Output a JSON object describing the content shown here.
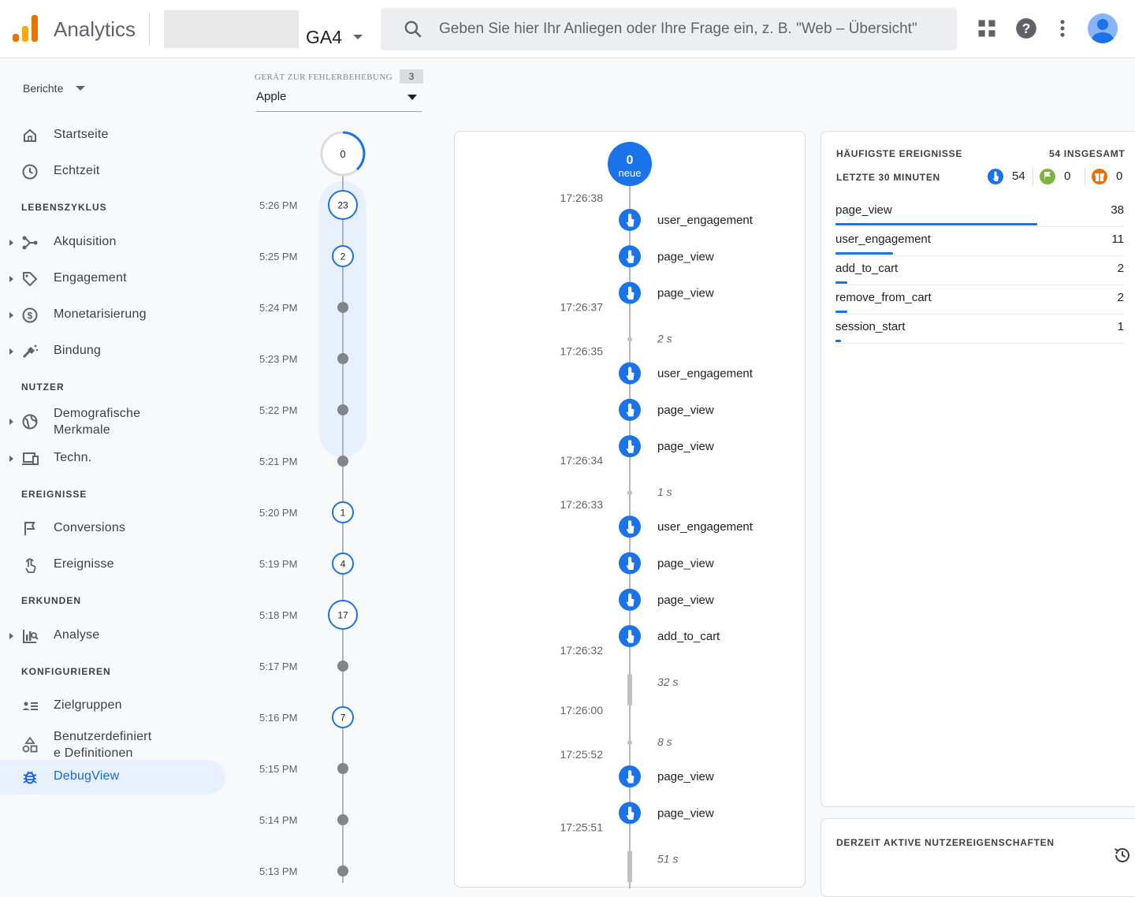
{
  "header": {
    "app_title": "Analytics",
    "property": "GA4",
    "search_placeholder": "Geben Sie hier Ihr Anliegen oder Ihre Frage ein, z. B. \"Web – Übersicht\"",
    "brand_colors": [
      "#f9ab00",
      "#e37400"
    ]
  },
  "sidebar": {
    "reports_label": "Berichte",
    "items": [
      {
        "label": "Startseite",
        "icon": "home-icon"
      },
      {
        "label": "Echtzeit",
        "icon": "clock-icon"
      },
      {
        "section": "LEBENSZYKLUS"
      },
      {
        "label": "Akquisition",
        "icon": "acquisition-icon",
        "expandable": true
      },
      {
        "label": "Engagement",
        "icon": "tag-icon",
        "expandable": true
      },
      {
        "label": "Monetarisierung",
        "icon": "dollar-icon",
        "expandable": true
      },
      {
        "label": "Bindung",
        "icon": "retention-icon",
        "expandable": true
      },
      {
        "section": "NUTZER"
      },
      {
        "label": "Demografische Merkmale",
        "icon": "globe-icon",
        "expandable": true
      },
      {
        "label": "Techn.",
        "icon": "devices-icon",
        "expandable": true
      },
      {
        "section": "EREIGNISSE"
      },
      {
        "label": "Conversions",
        "icon": "flag-icon"
      },
      {
        "label": "Ereignisse",
        "icon": "touch-icon"
      },
      {
        "section": "ERKUNDEN"
      },
      {
        "label": "Analyse",
        "icon": "explore-icon",
        "expandable": true
      },
      {
        "section": "KONFIGURIEREN"
      },
      {
        "label": "Zielgruppen",
        "icon": "audience-icon"
      },
      {
        "label": "Benutzerdefinierte Definitionen",
        "icon": "shapes-icon"
      },
      {
        "label": "DebugView",
        "icon": "bug-icon",
        "active": true
      }
    ]
  },
  "device": {
    "label": "GERÄT ZUR FEHLERBEHEBUNG",
    "count": "3",
    "selected": "Apple"
  },
  "minutes": {
    "top_count": "0",
    "rows": [
      {
        "time": "5:26 PM",
        "count": "23",
        "highlight": true
      },
      {
        "time": "5:25 PM",
        "count": "2",
        "highlight": true
      },
      {
        "time": "5:24 PM",
        "count": null,
        "highlight": true
      },
      {
        "time": "5:23 PM",
        "count": null,
        "highlight": true
      },
      {
        "time": "5:22 PM",
        "count": null,
        "highlight": true
      },
      {
        "time": "5:21 PM",
        "count": null
      },
      {
        "time": "5:20 PM",
        "count": "1"
      },
      {
        "time": "5:19 PM",
        "count": "4"
      },
      {
        "time": "5:18 PM",
        "count": "17"
      },
      {
        "time": "5:17 PM",
        "count": null
      },
      {
        "time": "5:16 PM",
        "count": "7"
      },
      {
        "time": "5:15 PM",
        "count": null
      },
      {
        "time": "5:14 PM",
        "count": null
      },
      {
        "time": "5:13 PM",
        "count": null
      }
    ]
  },
  "stream": {
    "top_count": "0",
    "top_label": "neue",
    "items": [
      {
        "kind": "time",
        "text": "17:26:38"
      },
      {
        "kind": "event",
        "text": "user_engagement"
      },
      {
        "kind": "event",
        "text": "page_view"
      },
      {
        "kind": "event",
        "text": "page_view"
      },
      {
        "kind": "time",
        "text": "17:26:37"
      },
      {
        "kind": "gap",
        "text": "2 s"
      },
      {
        "kind": "time",
        "text": "17:26:35"
      },
      {
        "kind": "event",
        "text": "user_engagement"
      },
      {
        "kind": "event",
        "text": "page_view"
      },
      {
        "kind": "event",
        "text": "page_view"
      },
      {
        "kind": "time",
        "text": "17:26:34"
      },
      {
        "kind": "gap",
        "text": "1 s"
      },
      {
        "kind": "time",
        "text": "17:26:33"
      },
      {
        "kind": "event",
        "text": "user_engagement"
      },
      {
        "kind": "event",
        "text": "page_view"
      },
      {
        "kind": "event",
        "text": "page_view"
      },
      {
        "kind": "event",
        "text": "add_to_cart"
      },
      {
        "kind": "time",
        "text": "17:26:32"
      },
      {
        "kind": "gap",
        "text": "32 s",
        "long": true
      },
      {
        "kind": "time",
        "text": "17:26:00"
      },
      {
        "kind": "gap",
        "text": "8 s"
      },
      {
        "kind": "time",
        "text": "17:25:52"
      },
      {
        "kind": "event",
        "text": "page_view"
      },
      {
        "kind": "event",
        "text": "page_view"
      },
      {
        "kind": "time",
        "text": "17:25:51"
      },
      {
        "kind": "gap",
        "text": "51 s",
        "long": true
      }
    ]
  },
  "top_events": {
    "title": "HÄUFIGSTE EREIGNISSE",
    "total": "54 INSGESAMT",
    "period": "LETZTE 30 MINUTEN",
    "counters": [
      {
        "icon": "touch-icon",
        "value": "54",
        "color": "#1a73e8"
      },
      {
        "icon": "flag-icon",
        "value": "0",
        "color": "#7cb342"
      },
      {
        "icon": "gift-icon",
        "value": "0",
        "color": "#e8710a"
      }
    ],
    "rows": [
      {
        "name": "page_view",
        "count": "38",
        "share": 0.7
      },
      {
        "name": "user_engagement",
        "count": "11",
        "share": 0.2
      },
      {
        "name": "add_to_cart",
        "count": "2",
        "share": 0.04
      },
      {
        "name": "remove_from_cart",
        "count": "2",
        "share": 0.04
      },
      {
        "name": "session_start",
        "count": "1",
        "share": 0.02
      }
    ]
  },
  "user_props": {
    "title": "DERZEIT AKTIVE NUTZEREIGENSCHAFTEN"
  }
}
